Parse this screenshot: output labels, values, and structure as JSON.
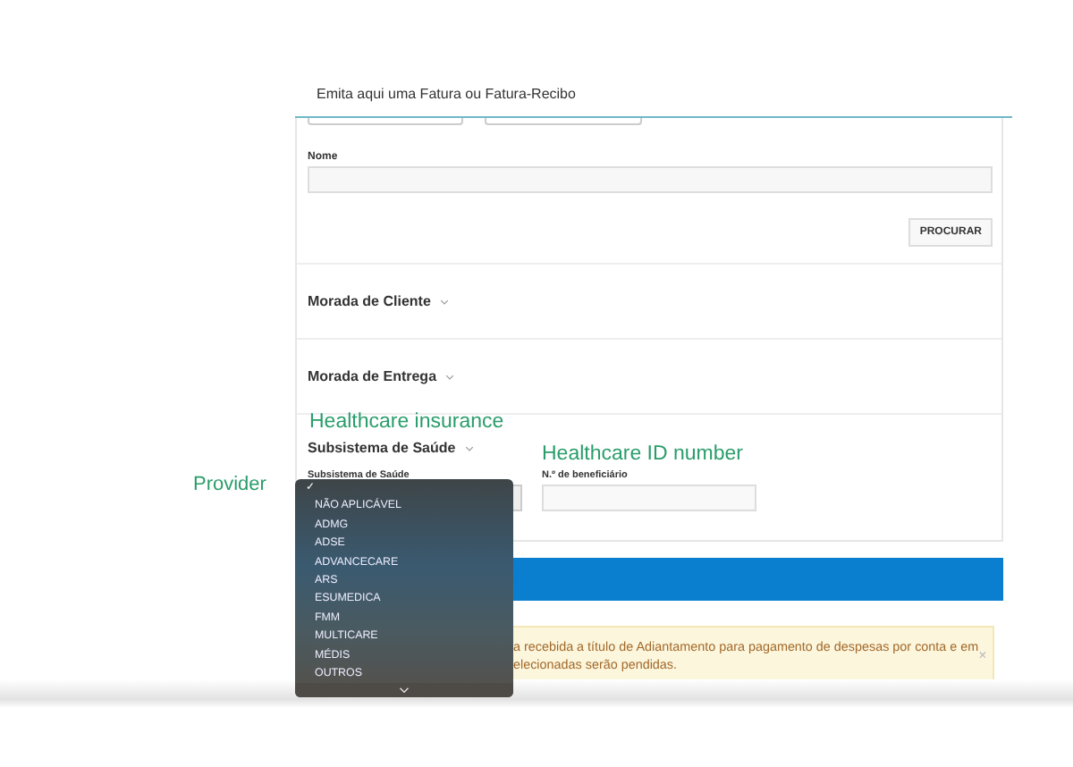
{
  "header": {
    "title": "Emita aqui uma Fatura ou Fatura-Recibo"
  },
  "search": {
    "name_label": "Nome",
    "button": "PROCURAR"
  },
  "sections": [
    {
      "title": "Morada de Cliente",
      "kind": "collapsed"
    },
    {
      "title": "Morada de Entrega",
      "kind": "collapsed"
    },
    {
      "title": "Subsistema de Saúde",
      "kind": "health"
    }
  ],
  "health": {
    "provider_label": "Subsistema de Saúde",
    "id_label": "N.º de beneficiário"
  },
  "annotations": [
    {
      "kind": "insurance",
      "text": "Healthcare insurance"
    },
    {
      "kind": "id",
      "text": "Healthcare ID number"
    },
    {
      "kind": "provider",
      "text": "Provider"
    }
  ],
  "alert": {
    "lines": [
      "a recebida a título de Adiantamento para pagamento de despesas por conta e em",
      "elecionadas serão pendidas."
    ],
    "close": "×"
  },
  "dropdown": {
    "blank_option": {
      "mark": "✓",
      "selected": true
    },
    "options": [
      {
        "label": "NÃO APLICÁVEL",
        "selected": false
      },
      {
        "label": "ADMG",
        "selected": false
      },
      {
        "label": "ADSE",
        "selected": false
      },
      {
        "label": "ADVANCECARE",
        "selected": false
      },
      {
        "label": "ARS",
        "selected": false
      },
      {
        "label": "ESUMEDICA",
        "selected": false
      },
      {
        "label": "FMM",
        "selected": false
      },
      {
        "label": "MULTICARE",
        "selected": false
      },
      {
        "label": "MÉDIS",
        "selected": false
      },
      {
        "label": "OUTROS",
        "selected": false
      }
    ]
  }
}
